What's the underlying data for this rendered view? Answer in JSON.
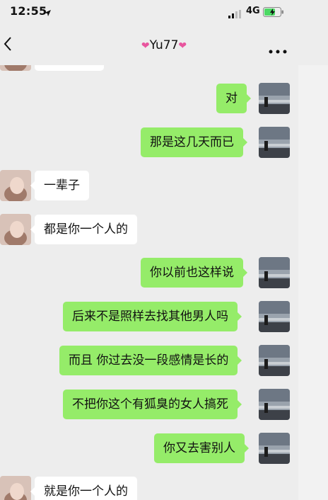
{
  "status_bar": {
    "time": "12:55",
    "network": "4G",
    "icons": [
      "location-arrow-icon",
      "signal-icon",
      "battery-charging-icon"
    ]
  },
  "nav": {
    "title": "Yu77",
    "back_icon": "chevron-left-icon",
    "more_icon": "more-dots-icon",
    "title_emoji": "heart-emoji"
  },
  "colors": {
    "background": "#ededed",
    "outgoing_bubble": "#95ec69",
    "incoming_bubble": "#ffffff",
    "heart": "#e8559e"
  },
  "messages": [
    {
      "dir": "in",
      "text": ""
    },
    {
      "dir": "out",
      "text": "对"
    },
    {
      "dir": "out",
      "text": "那是这几天而已"
    },
    {
      "dir": "in",
      "text": "一辈子"
    },
    {
      "dir": "in",
      "text": "都是你一个人的"
    },
    {
      "dir": "out",
      "text": "你以前也这样说"
    },
    {
      "dir": "out",
      "text": "后来不是照样去找其他男人吗"
    },
    {
      "dir": "out",
      "text": "而且 你过去没一段感情是长的"
    },
    {
      "dir": "out",
      "text": "不把你这个有狐臭的女人搞死"
    },
    {
      "dir": "out",
      "text": "你又去害别人"
    },
    {
      "dir": "in",
      "text": "就是你一个人的"
    }
  ]
}
